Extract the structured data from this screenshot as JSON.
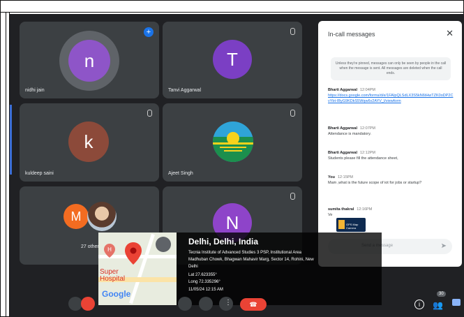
{
  "tiles": [
    {
      "name": "nidhi jain",
      "initial": "n",
      "color": "#8e55c8"
    },
    {
      "name": "Tanvi Aggarwal",
      "initial": "T",
      "color": "#7b3fc4"
    },
    {
      "name": "kuldeep saini",
      "initial": "k",
      "color": "#8c4a3a"
    },
    {
      "name": "Ajeet Singh",
      "initial": "",
      "color": "#2a9d60"
    },
    {
      "name": "27 others",
      "initial": "M",
      "color": "#f36c21"
    },
    {
      "name": "",
      "initial": "N",
      "color": "#8e44c9"
    }
  ],
  "chat": {
    "title": "In-call messages",
    "notice": "Unless they're pinned, messages can only be seen by people in the call when the message is sent. All messages are deleted when the call ends.",
    "messages": [
      {
        "sender": "Bharti Aggarwal",
        "time": "12:04PM",
        "text": "https://docs.google.com/forms/d/e/1FAIpQLSdLX3S5kN6tHwTZK0oDP2CvYbt-IByG9KDkS5Wqw6v2AYV_l/viewform"
      },
      {
        "sender": "Bharti Aggarwal",
        "time": "12:07PM",
        "text": "Attendance is mandatory."
      },
      {
        "sender": "Bharti Aggarwal",
        "time": "12:12PM",
        "text": "Students please fill the attendance sheet,"
      },
      {
        "sender": "You",
        "time": "12:15PM",
        "text": "Mam ,what is the future scope of iot for jobs or startup?"
      },
      {
        "sender": "sumita thakral",
        "time": "12:16PM",
        "text": "Ve"
      }
    ],
    "input_placeholder": "Send a message",
    "thumb_label": "GPS Map Camera"
  },
  "gps": {
    "title": "Delhi, Delhi, India",
    "address1": "Tecnia Institute of Advanced Studies 3 PSP, Institutional Area",
    "address2": "Madhuban Chowk, Bhagwan Mahavir Marg, Sector 14, Rohini, New",
    "address3": "Delhi",
    "lat": "Lat 27.623355°",
    "long": "Long 72.335296°",
    "datetime": "11/05/24 12:15 AM",
    "map_label": "Super Hospital",
    "map_brand": "Google"
  },
  "toolbar": {
    "people_badge": "30"
  }
}
